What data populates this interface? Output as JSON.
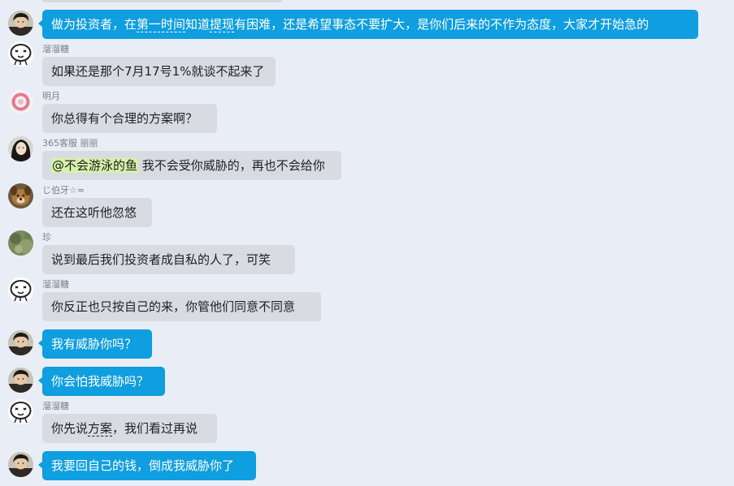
{
  "colors": {
    "background": "#e9eef6",
    "self_bubble": "#0f9ee0",
    "other_bubble": "#d8dce2",
    "mention_highlight": "#d5f2a9"
  },
  "messages": [
    {
      "side": "self",
      "avatar": "avatar-photo-dark-hair",
      "sender": "",
      "parts": [
        {
          "text": "做为投资者，在"
        },
        {
          "text": "第一时间",
          "style": "dotted"
        },
        {
          "text": "知道"
        },
        {
          "text": "提现",
          "style": "dotted"
        },
        {
          "text": "有困难，还是希望事态不要扩大，是你们后来的不作为态度，大家才开始急的"
        }
      ]
    },
    {
      "side": "other",
      "avatar": "avatar-cartoon-face",
      "sender": "溜溜糖",
      "parts": [
        {
          "text": "如果还是那个7月17号1%就谈不起来了"
        }
      ]
    },
    {
      "side": "other",
      "avatar": "avatar-pink-flower",
      "sender": "明月",
      "parts": [
        {
          "text": "你总得有个合理的方案啊？"
        }
      ]
    },
    {
      "side": "other",
      "avatar": "avatar-photo-woman",
      "sender": "365客服  丽丽",
      "parts": [
        {
          "text": "@不会游泳的鱼",
          "style": "mention"
        },
        {
          "text": " 我不会受你威胁的，再也不会给你"
        }
      ]
    },
    {
      "side": "other",
      "avatar": "avatar-photo-dog",
      "sender": "じ伯牙☆≈",
      "parts": [
        {
          "text": "还在这听他忽悠"
        }
      ]
    },
    {
      "side": "other",
      "avatar": "avatar-photo-green",
      "sender": "珍",
      "parts": [
        {
          "text": "说到最后我们投资者成自私的人了，可笑"
        }
      ]
    },
    {
      "side": "other",
      "avatar": "avatar-cartoon-face",
      "sender": "溜溜糖",
      "parts": [
        {
          "text": "你反正也只按自己的来，你管他们同意不同意"
        }
      ]
    },
    {
      "side": "self",
      "avatar": "avatar-photo-dark-hair",
      "sender": "",
      "parts": [
        {
          "text": "我有威胁你吗？"
        }
      ]
    },
    {
      "side": "self",
      "avatar": "avatar-photo-dark-hair",
      "sender": "",
      "parts": [
        {
          "text": "你会怕我威胁吗？"
        }
      ]
    },
    {
      "side": "other",
      "avatar": "avatar-cartoon-face",
      "sender": "溜溜糖",
      "parts": [
        {
          "text": "你先说"
        },
        {
          "text": "方案",
          "style": "dotted"
        },
        {
          "text": "，我们看过再说"
        }
      ]
    },
    {
      "side": "self",
      "avatar": "avatar-photo-dark-hair",
      "sender": "",
      "parts": [
        {
          "text": "我要回自己的钱，倒成我威胁你了"
        }
      ]
    }
  ]
}
